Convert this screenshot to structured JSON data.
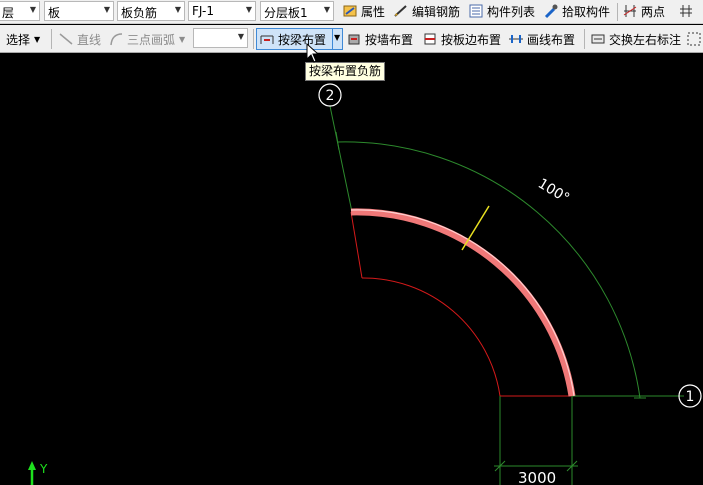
{
  "toolbar_top": {
    "floor_label": "层",
    "type_label": "板",
    "subtype_label": "板负筋",
    "component_label": "FJ-1",
    "layer_label": "分层板1",
    "properties": "属性",
    "edit_rebar": "编辑钢筋",
    "component_list": "构件列表",
    "pick_component": "拾取构件",
    "two_point": "两点"
  },
  "toolbar_draw": {
    "select": "选择",
    "line": "直线",
    "arc3": "三点画弧",
    "combo_value": "",
    "by_beam": "按梁布置",
    "by_wall": "按墙布置",
    "by_slab_edge": "按板边布置",
    "draw_line": "画线布置",
    "swap_labels": "交换左右标注"
  },
  "tooltip": "按梁布置负筋",
  "canvas": {
    "axis_2": "2",
    "axis_1": "1",
    "angle_label": "100°",
    "dimension_label": "3000",
    "y_axis": "Y"
  },
  "colors": {
    "rebar": "#f07878",
    "dim_green": "#2d8a2d",
    "edge_red": "#d41a1a",
    "cursor_yellow": "#e8e020"
  }
}
